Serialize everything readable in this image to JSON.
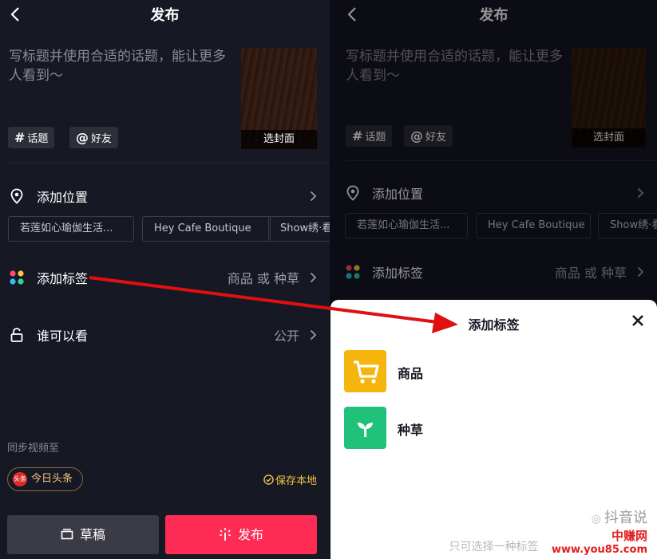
{
  "left": {
    "header": {
      "title": "发布"
    },
    "caption_placeholder": "写标题并使用合适的话题，能让更多人看到～",
    "cover_label": "选封面",
    "chips": {
      "topic": "话题",
      "friend": "好友"
    },
    "location": {
      "label": "添加位置",
      "suggestions": [
        "若莲如心瑜伽生活...",
        "Hey Cafe Boutique",
        "Show绣·看"
      ]
    },
    "tag": {
      "label": "添加标签",
      "value": "商品 或 种草"
    },
    "visibility": {
      "label": "谁可以看",
      "value": "公开"
    },
    "sync": {
      "label": "同步视频至",
      "toutiao": "今日头条",
      "toutiao_badge": "头条",
      "save_local": "保存本地"
    },
    "buttons": {
      "draft": "草稿",
      "publish": "发布"
    }
  },
  "right": {
    "header": {
      "title": "发布"
    },
    "caption_placeholder": "写标题并使用合适的话题，能让更多人看到～",
    "cover_label": "选封面",
    "chips": {
      "topic": "话题",
      "friend": "好友"
    },
    "location": {
      "label": "添加位置",
      "suggestions": [
        "若莲如心瑜伽生活...",
        "Hey Cafe Boutique",
        "Show绣·看"
      ]
    },
    "tag": {
      "label": "添加标签",
      "value": "商品 或 种草"
    },
    "sheet": {
      "title": "添加标签",
      "options": [
        {
          "label": "商品",
          "icon": "cart-icon",
          "color": "#f5b50c"
        },
        {
          "label": "种草",
          "icon": "sprout-icon",
          "color": "#20c27a"
        }
      ],
      "footer": "只可选择一种标签"
    }
  },
  "watermark": {
    "line1": "抖音说",
    "brand": "中赚网",
    "url": "www.you85.com"
  },
  "colors": {
    "bg": "#161823",
    "accent": "#fe2c55",
    "gold": "#f6c34a",
    "arrow": "#e01010"
  }
}
